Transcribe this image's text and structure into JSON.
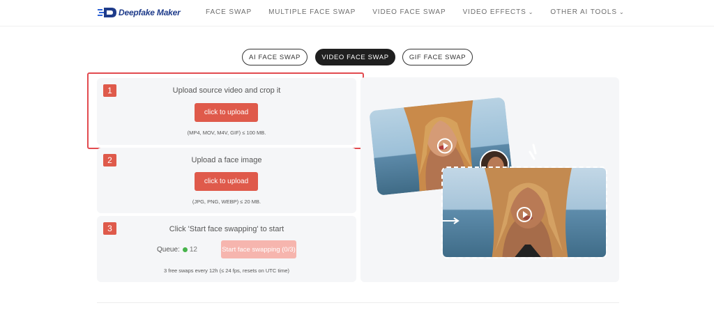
{
  "brand": {
    "name": "Deepfake Maker",
    "color": "#1e3b8a"
  },
  "nav": {
    "items": [
      {
        "label": "FACE SWAP",
        "dropdown": false
      },
      {
        "label": "MULTIPLE FACE SWAP",
        "dropdown": false
      },
      {
        "label": "VIDEO FACE SWAP",
        "dropdown": false
      },
      {
        "label": "VIDEO EFFECTS",
        "dropdown": true
      },
      {
        "label": "OTHER AI TOOLS",
        "dropdown": true
      }
    ],
    "caret": "⌄"
  },
  "tabs": [
    {
      "label": "AI FACE SWAP",
      "active": false
    },
    {
      "label": "VIDEO FACE SWAP",
      "active": true
    },
    {
      "label": "GIF FACE SWAP",
      "active": false
    }
  ],
  "steps": [
    {
      "number": "1",
      "title": "Upload source video and crop it",
      "button": "click to upload",
      "note": "(MP4, MOV, M4V, GIF) ≤ 100 MB."
    },
    {
      "number": "2",
      "title": "Upload a face image",
      "button": "click to upload",
      "note": "(JPG, PNG, WEBP) ≤ 20 MB."
    },
    {
      "number": "3",
      "title": "Click 'Start face swapping' to start",
      "queue_label": "Queue:",
      "queue_count": "12",
      "start_button": "Start face swapping (0/3)",
      "note": "3 free swaps every 12h (≤ 24 fps, resets on UTC time)"
    }
  ],
  "colors": {
    "accent": "#df5a4b",
    "accent_disabled": "#f6b5ae",
    "highlight": "#e24a4f",
    "queue_ok": "#47b34b"
  }
}
